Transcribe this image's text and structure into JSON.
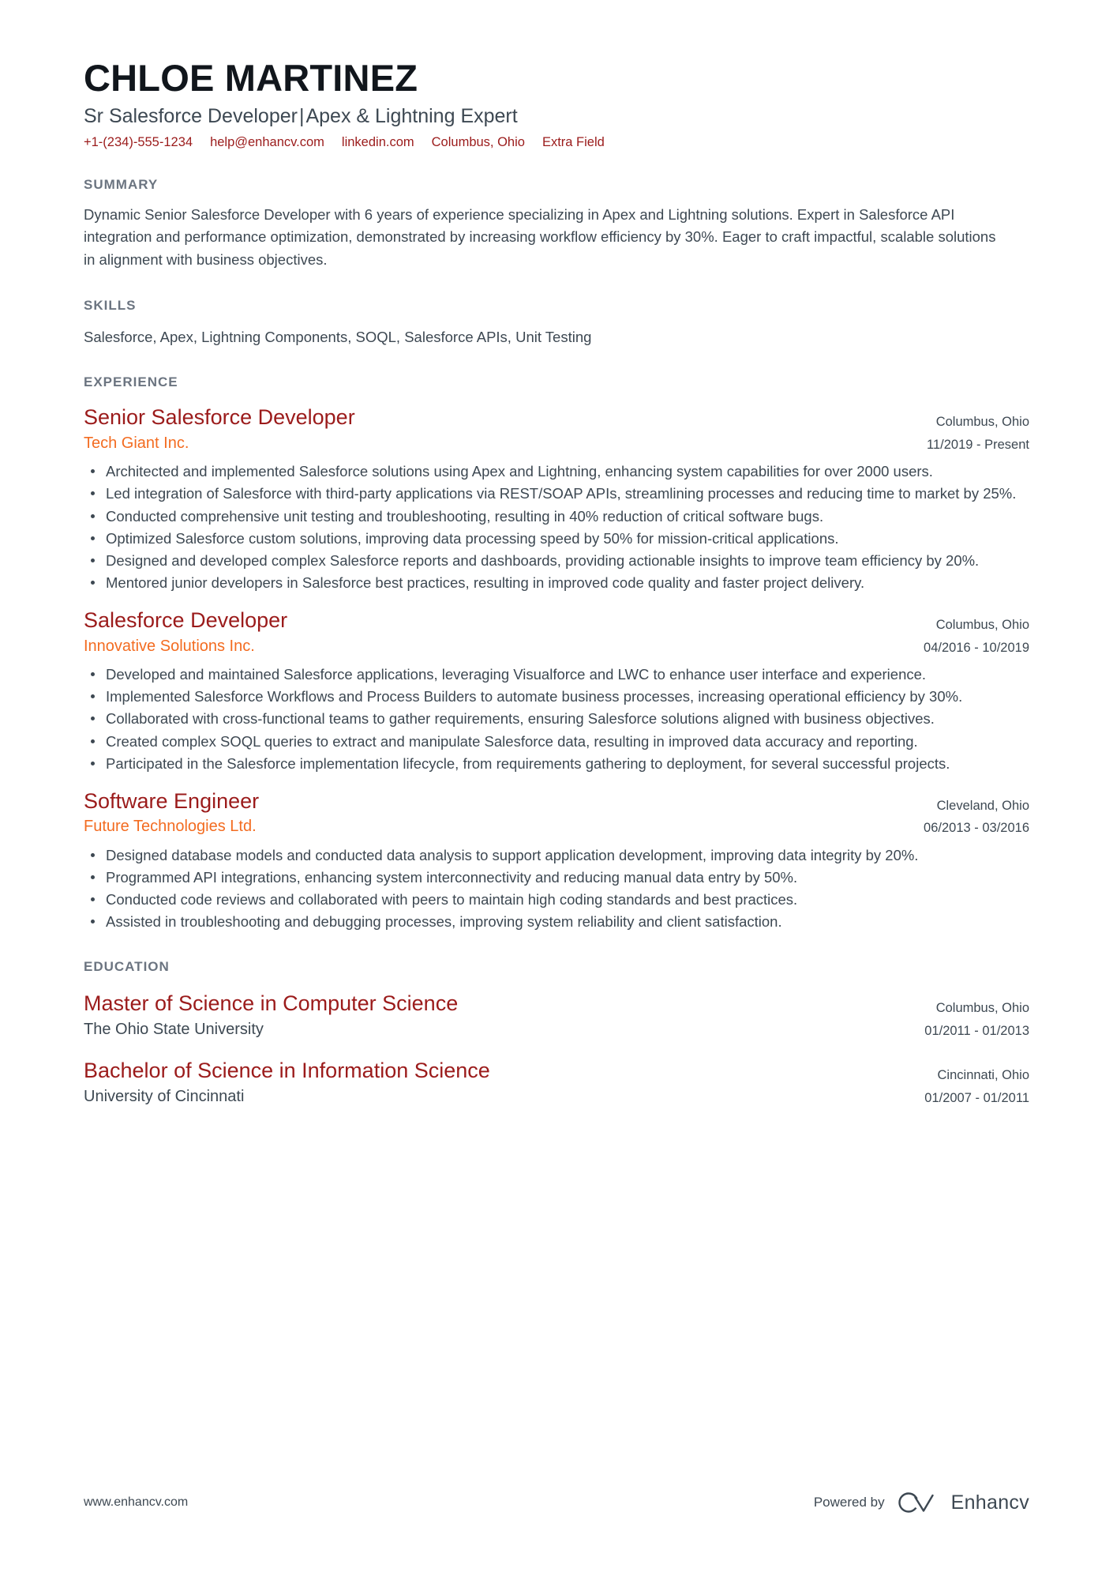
{
  "header": {
    "name": "CHLOE MARTINEZ",
    "headline_left": "Sr Salesforce Developer",
    "headline_sep": "|",
    "headline_right": "Apex & Lightning Expert",
    "contacts": [
      {
        "name": "phone",
        "text": "+1-(234)-555-1234"
      },
      {
        "name": "email",
        "text": "help@enhancv.com"
      },
      {
        "name": "linkedin",
        "text": "linkedin.com"
      },
      {
        "name": "location",
        "text": "Columbus, Ohio"
      },
      {
        "name": "extra-field",
        "text": "Extra Field"
      }
    ]
  },
  "summary": {
    "title": "SUMMARY",
    "text": "Dynamic Senior Salesforce Developer with 6 years of experience specializing in Apex and Lightning solutions. Expert in Salesforce API integration and performance optimization, demonstrated by increasing workflow efficiency by 30%. Eager to craft impactful, scalable solutions in alignment with business objectives."
  },
  "skills": {
    "title": "SKILLS",
    "text": "Salesforce, Apex, Lightning Components, SOQL, Salesforce APIs, Unit Testing"
  },
  "experience": {
    "title": "EXPERIENCE",
    "entries": [
      {
        "title": "Senior Salesforce Developer",
        "company": "Tech Giant Inc.",
        "location": "Columbus, Ohio",
        "dates": "11/2019 - Present",
        "bullets": [
          "Architected and implemented Salesforce solutions using Apex and Lightning, enhancing system capabilities for over 2000 users.",
          "Led integration of Salesforce with third-party applications via REST/SOAP APIs, streamlining processes and reducing time to market by 25%.",
          "Conducted comprehensive unit testing and troubleshooting, resulting in 40% reduction of critical software bugs.",
          "Optimized Salesforce custom solutions, improving data processing speed by 50% for mission-critical applications.",
          "Designed and developed complex Salesforce reports and dashboards, providing actionable insights to improve team efficiency by 20%.",
          "Mentored junior developers in Salesforce best practices, resulting in improved code quality and faster project delivery."
        ]
      },
      {
        "title": "Salesforce Developer",
        "company": "Innovative Solutions Inc.",
        "location": "Columbus, Ohio",
        "dates": "04/2016 - 10/2019",
        "bullets": [
          "Developed and maintained Salesforce applications, leveraging Visualforce and LWC to enhance user interface and experience.",
          "Implemented Salesforce Workflows and Process Builders to automate business processes, increasing operational efficiency by 30%.",
          "Collaborated with cross-functional teams to gather requirements, ensuring Salesforce solutions aligned with business objectives.",
          "Created complex SOQL queries to extract and manipulate Salesforce data, resulting in improved data accuracy and reporting.",
          "Participated in the Salesforce implementation lifecycle, from requirements gathering to deployment, for several successful projects."
        ]
      },
      {
        "title": "Software Engineer",
        "company": "Future Technologies Ltd.",
        "location": "Cleveland, Ohio",
        "dates": "06/2013 - 03/2016",
        "bullets": [
          "Designed database models and conducted data analysis to support application development, improving data integrity by 20%.",
          "Programmed API integrations, enhancing system interconnectivity and reducing manual data entry by 50%.",
          "Conducted code reviews and collaborated with peers to maintain high coding standards and best practices.",
          "Assisted in troubleshooting and debugging processes, improving system reliability and client satisfaction."
        ]
      }
    ]
  },
  "education": {
    "title": "EDUCATION",
    "entries": [
      {
        "degree": "Master of Science in Computer Science",
        "school": "The Ohio State University",
        "location": "Columbus, Ohio",
        "dates": "01/2011 - 01/2013"
      },
      {
        "degree": "Bachelor of Science in Information Science",
        "school": "University of Cincinnati",
        "location": "Cincinnati, Ohio",
        "dates": "01/2007 - 01/2011"
      }
    ]
  },
  "footer": {
    "url": "www.enhancv.com",
    "powered_by": "Powered by",
    "brand": "Enhancv"
  },
  "colors": {
    "accent_red": "#9b1b1b",
    "accent_orange": "#f36c21",
    "section_header": "#6b7480",
    "body_text": "#3d4852",
    "name_text": "#11161c"
  }
}
